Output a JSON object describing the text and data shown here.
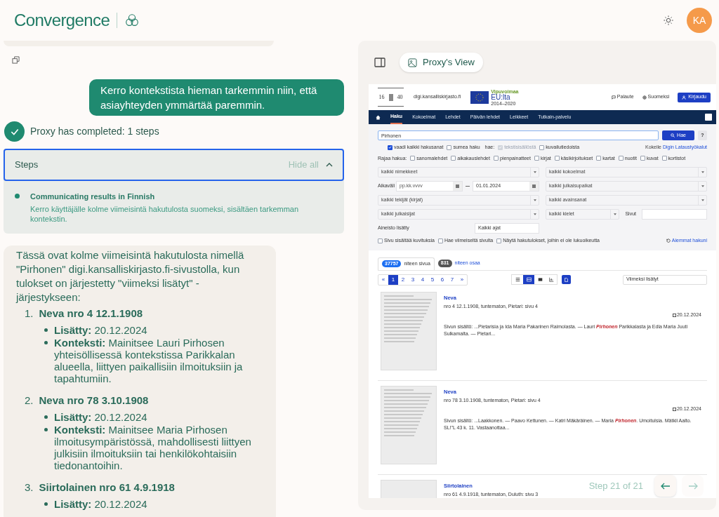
{
  "header": {
    "brand": "Convergence",
    "avatar": "KA"
  },
  "chat": {
    "user_message": "Kerro kontekstista hieman tarkemmin niin, että asiayhteyden ymmärtää paremmin.",
    "status": "Proxy has completed: 1 steps",
    "steps": {
      "title": "Steps",
      "toggle": "Hide all",
      "expanded": true,
      "items": [
        {
          "title": "Communicating results in Finnish",
          "description": "Kerro käyttäjälle kolme viimeisintä hakutulosta suomeksi, sisältäen tarkemman kontekstin."
        }
      ]
    },
    "answer": {
      "intro": "Tässä ovat kolme viimeisintä hakutulosta nimellä \"Pirhonen\" digi.kansalliskirjasto.fi-sivustolla, kun tulokset on järjestetty \"viimeksi lisätyt\" -järjestykseen:",
      "results": [
        {
          "number": "1.",
          "title": "Neva nro 4 12.1.1908",
          "details": [
            {
              "label": "Lisätty:",
              "value": "20.12.2024"
            },
            {
              "label": "Konteksti:",
              "value": "Mainitsee Lauri Pirhosen yhteisöllisessä kontekstissa Parikkalan alueella, liittyen paikallisiin ilmoituksiin ja tapahtumiin."
            }
          ]
        },
        {
          "number": "2.",
          "title": "Neva nro 78 3.10.1908",
          "details": [
            {
              "label": "Lisätty:",
              "value": "20.12.2024"
            },
            {
              "label": "Konteksti:",
              "value": "Mainitsee Maria Pirhosen ilmoitusympäristössä, mahdollisesti liittyen julkisiin ilmoituksiin tai henkilökohtaisiin tiedonantoihin."
            }
          ]
        },
        {
          "number": "3.",
          "title": "Siirtolainen nro 61 4.9.1918",
          "details": [
            {
              "label": "Lisätty:",
              "value": "20.12.2024"
            }
          ]
        }
      ]
    }
  },
  "proxy_view": {
    "button": "Proxy's View",
    "step_label": "Step 21 of 21",
    "prev_disabled": false,
    "next_disabled": true,
    "site": {
      "logo": [
        "16",
        "40"
      ],
      "domain": "digi.kansalliskirjasto.fi",
      "eu_logo": {
        "tagline": "Vipuvoimaa",
        "title": "EU:lta",
        "years": "2014–2020"
      },
      "links": [
        "Palaute",
        "Suomeksi"
      ],
      "login": "Kirjaudu",
      "nav": [
        {
          "label": "Haku",
          "selected": true
        },
        {
          "label": "Kokoelmat",
          "selected": false
        },
        {
          "label": "Lehdet",
          "selected": false
        },
        {
          "label": "Päivän lehdet",
          "selected": false
        },
        {
          "label": "Leikkeet",
          "selected": false
        },
        {
          "label": "Tutkain-palvelu",
          "selected": false
        }
      ],
      "search": {
        "value": "Pirhonen",
        "button": "Hae",
        "help": "?"
      },
      "options_a": [
        {
          "label": "vaadi kaikki hakusanat",
          "checked": true,
          "disabled": false
        },
        {
          "label": "sumea haku",
          "checked": false,
          "disabled": false
        }
      ],
      "scope_label": "hae:",
      "options_b": [
        {
          "label": "tekstisisällöstä",
          "checked": true,
          "disabled": true
        },
        {
          "label": "kuvailutiedoista",
          "checked": false,
          "disabled": false
        }
      ],
      "tools_hint": {
        "text": "Kokeile",
        "link": "Digin Lataustyökalut"
      },
      "filter_label": "Rajaa hakua:",
      "filters": [
        {
          "label": "sanomalehdet",
          "checked": false
        },
        {
          "label": "aikakauslehdet",
          "checked": false
        },
        {
          "label": "pienpainatteet",
          "checked": false
        },
        {
          "label": "kirjat",
          "checked": false
        },
        {
          "label": "käsikirjoitukset",
          "checked": false
        },
        {
          "label": "kartat",
          "checked": false
        },
        {
          "label": "nuotit",
          "checked": false
        },
        {
          "label": "kuvat",
          "checked": false
        },
        {
          "label": "kortistot",
          "checked": false
        }
      ],
      "fields": {
        "title": "kaikki nimekkeet",
        "collection": "kaikki kokoelmat",
        "range_label": "Aikaväli",
        "range_from_placeholder": "pp.kk.vvvv",
        "range_to": "01.01.2024",
        "place": "kaikki julkaisupaikat",
        "author": "kaikki tekijät (kirjat)",
        "keyword": "kaikki avainsanat",
        "publisher": "kaikki julkaisijat",
        "language": "kaikki kielet",
        "pages_label": "Sivut",
        "added_label": "Aineisto lisätty",
        "added": "Kaikki ajat"
      },
      "extra_options": [
        {
          "label": "Sivu sisältää kuvituksia",
          "checked": false
        },
        {
          "label": "Hae viimeiseltä sivulta",
          "checked": false
        },
        {
          "label": "Näytä hakutulokset, joihin ei ole lukuoikeutta",
          "checked": false
        }
      ],
      "history_link": "Aiemmat hakuni",
      "result_tabs": [
        {
          "count": "37757",
          "label": "niteen sivua",
          "selected": true
        },
        {
          "count": "831",
          "label": "niteen osaa",
          "selected": false
        }
      ],
      "pages": [
        {
          "label": "«",
          "selected": false
        },
        {
          "label": "1",
          "selected": true
        },
        {
          "label": "2",
          "selected": false
        },
        {
          "label": "3",
          "selected": false
        },
        {
          "label": "4",
          "selected": false
        },
        {
          "label": "5",
          "selected": false
        },
        {
          "label": "6",
          "selected": false
        },
        {
          "label": "7",
          "selected": false
        },
        {
          "label": "»",
          "selected": false
        }
      ],
      "views": [
        {
          "kind": "list",
          "selected": false
        },
        {
          "kind": "card",
          "selected": true
        },
        {
          "kind": "image",
          "selected": false
        },
        {
          "kind": "chart",
          "selected": false
        }
      ],
      "sort": "Viimeksi lisätyt",
      "results": [
        {
          "title": "Neva",
          "meta": "nro 4 12.1.1908, tuntematon, Pietari: sivu 4",
          "date": "20.12.2024",
          "snippet": "Sivun sisältö: ...Pietarisia ja Ida Maria Pakarinen Raimolasta. — Lauri **Pirhonen** Parikkalasta ja Edla Maria Juuti Sulkamalta. — Pietari..."
        },
        {
          "title": "Neva",
          "meta": "nro 78 3.10.1908, tuntematon, Pietari: sivu 4",
          "date": "20.12.2024",
          "snippet": "Sivun sisältö: ...Laakkonen. — Paavo Kettunen. — Katri Mäkäräinen. — Maria **Pirhonen**. Umoitulsia. Mätkii Aalto. SL!\"L 43 k. 11. Vastaanottaa..."
        },
        {
          "title": "Siirtolainen",
          "meta": "nro 61 4.9.1918, tuntematon, Duluth: sivu 3"
        }
      ]
    }
  }
}
